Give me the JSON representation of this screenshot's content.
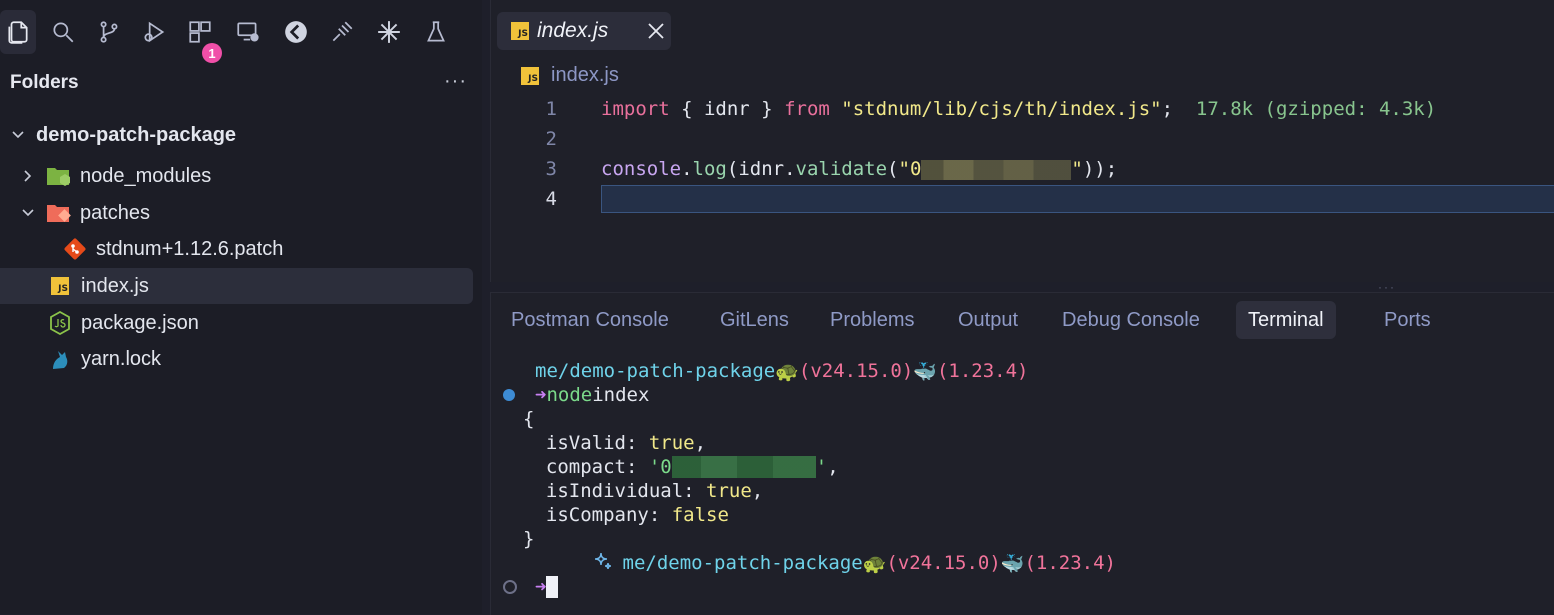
{
  "sidebar": {
    "header": "Folders",
    "more": "···",
    "extensions_badge": "1",
    "tree": [
      {
        "label": "demo-patch-package"
      },
      {
        "label": "node_modules"
      },
      {
        "label": "patches"
      },
      {
        "label": "stdnum+1.12.6.patch"
      },
      {
        "label": "index.js"
      },
      {
        "label": "package.json"
      },
      {
        "label": "yarn.lock"
      }
    ]
  },
  "editor": {
    "tab_label": "index.js",
    "breadcrumb": "index.js",
    "js_badge": "JS",
    "line_numbers": [
      "1",
      "2",
      "3",
      "4"
    ],
    "line1": {
      "import_kw": "import",
      "braces_open": " { ",
      "ident": "idnr",
      "braces_close": " } ",
      "from_kw": "from",
      "space": " ",
      "module": "\"stdnum/lib/cjs/th/index.js\"",
      "semi": ";",
      "size_hint": "17.8k (gzipped: 4.3k)"
    },
    "line3": {
      "obj": "console",
      "dot1": ".",
      "method": "log",
      "paren1": "(",
      "ident": "idnr",
      "dot2": ".",
      "method2": "validate",
      "paren2": "(",
      "str_start": "\"0",
      "str_end": "\"",
      "close": "));"
    }
  },
  "panel": {
    "tabs": [
      "Postman Console",
      "GitLens",
      "Problems",
      "Output",
      "Debug Console",
      "Terminal",
      "Ports"
    ],
    "active_tab": "Terminal"
  },
  "terminal": {
    "prompt_path": "me/demo-patch-package",
    "node_emoji": "🐢",
    "node_version": "(v24.15.0)",
    "docker_emoji": "🐳",
    "docker_version": "(1.23.4)",
    "arrow": "➜",
    "command_bin": "node",
    "command_arg": "index",
    "output_open": "{",
    "isValid_key": "  isValid: ",
    "isValid_val": "true",
    "compact_key": "  compact: ",
    "compact_start": "'0",
    "compact_end": "'",
    "isIndividual_key": "  isIndividual: ",
    "isIndividual_val": "true",
    "isCompany_key": "  isCompany: ",
    "isCompany_val": "false",
    "comma": ",",
    "output_close": "}"
  }
}
